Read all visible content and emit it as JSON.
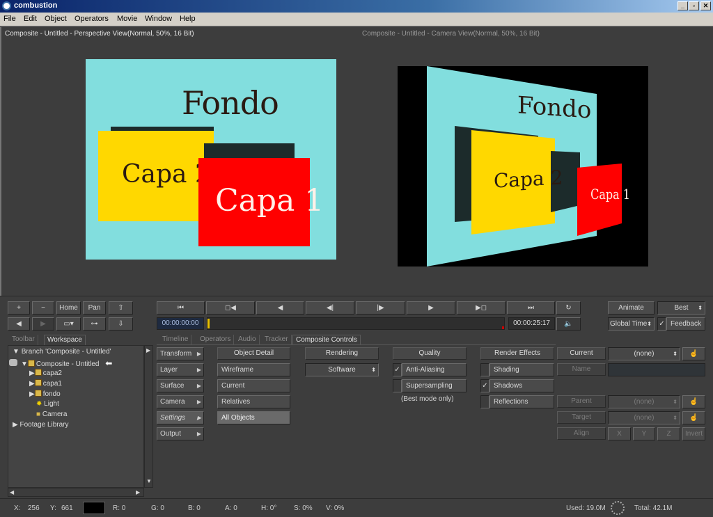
{
  "window": {
    "title": "combustion",
    "min": "_",
    "max": "▫",
    "close": "✕"
  },
  "menu": [
    "File",
    "Edit",
    "Object",
    "Operators",
    "Movie",
    "Window",
    "Help"
  ],
  "viewports": {
    "left_label": "Composite - Untitled - Perspective View(Normal, 50%, 16 Bit)",
    "right_label": "Composite - Untitled - Camera View(Normal, 50%, 16 Bit)",
    "scene_title": "Fondo",
    "layer2": "Capa 2",
    "layer1": "Capa 1",
    "colors": {
      "fondo": "#82dede",
      "capa2": "#ffd800",
      "capa1": "#ff0000",
      "shadow": "#1c2b2b"
    }
  },
  "view_tools": {
    "plus": "+",
    "minus": "−",
    "home": "Home",
    "pan": "Pan"
  },
  "transport": {
    "current_time": "00:00:00:00",
    "end_time": "00:00:25:17",
    "animate": "Animate",
    "quality": "Best",
    "global_time": "Global Time",
    "feedback": "Feedback"
  },
  "left_tabs": [
    "Toolbar",
    "Workspace"
  ],
  "tree": {
    "branch": "Branch 'Composite - Untitled'",
    "composite": "Composite - Untitled",
    "items": [
      "capa2",
      "capa1",
      "fondo",
      "Light",
      "Camera"
    ],
    "footage": "Footage Library"
  },
  "tabs": [
    "Timeline",
    "Operators",
    "Audio",
    "Tracker",
    "Composite Controls"
  ],
  "controls": {
    "categories": [
      "Transform",
      "Layer",
      "Surface",
      "Camera",
      "Settings",
      "Output"
    ],
    "object_detail": {
      "header": "Object Detail",
      "items": [
        "Wireframe",
        "Current",
        "Relatives",
        "All Objects"
      ]
    },
    "rendering": {
      "header": "Rendering",
      "value": "Software"
    },
    "quality": {
      "header": "Quality",
      "anti_aliasing": "Anti-Aliasing",
      "supersampling": "Supersampling",
      "note": "(Best mode only)"
    },
    "render_effects": {
      "header": "Render Effects",
      "shading": "Shading",
      "shadows": "Shadows",
      "reflections": "Reflections"
    },
    "camera": {
      "current": "Current",
      "current_value": "(none)",
      "name": "Name",
      "parent": "Parent",
      "parent_value": "(none)",
      "target": "Target",
      "target_value": "(none)",
      "align": "Align",
      "x": "X",
      "y": "Y",
      "z": "Z",
      "invert": "Invert"
    }
  },
  "status": {
    "x_label": "X:",
    "x": "256",
    "y_label": "Y:",
    "y": "661",
    "r": "R: 0",
    "g": "G: 0",
    "b": "B: 0",
    "a": "A: 0",
    "h": "H: 0°",
    "s": "S: 0%",
    "v": "V: 0%",
    "used": "Used: 19.0M",
    "total": "Total: 42.1M"
  }
}
